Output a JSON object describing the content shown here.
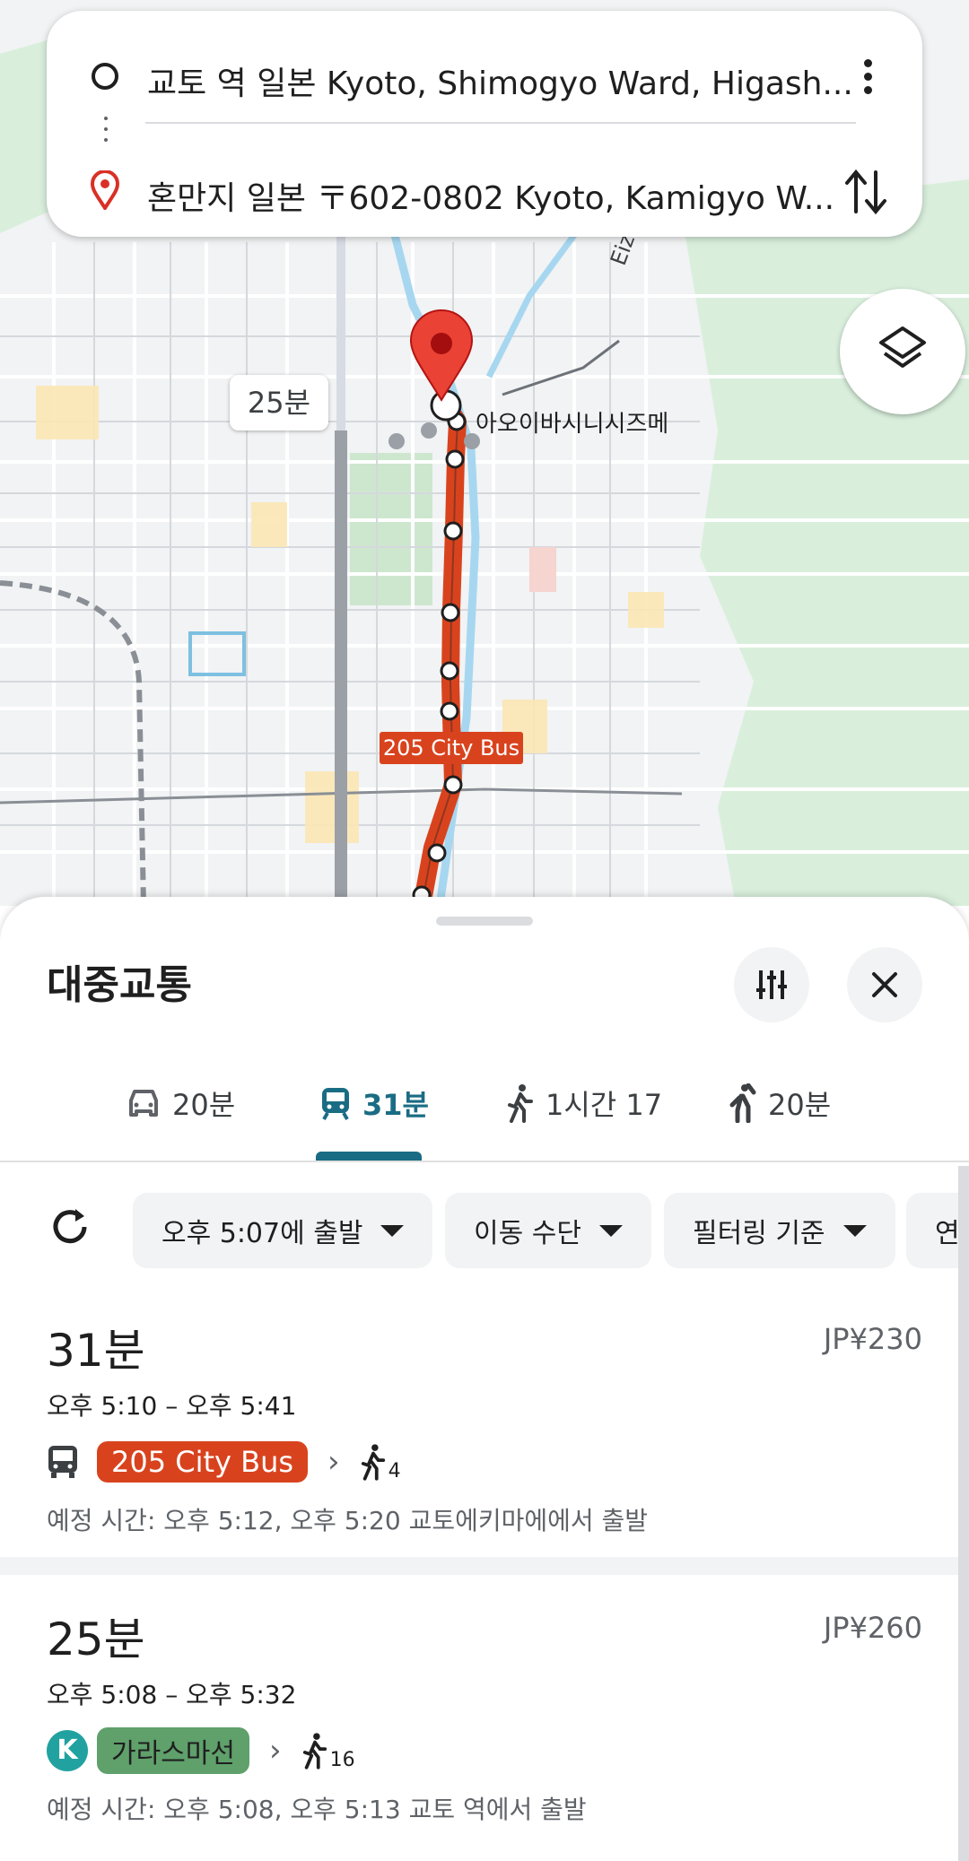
{
  "search": {
    "origin": "교토 역 일본 Kyoto, Shimogyo Ward, Higash...",
    "destination": "혼만지 일본 〒602-0802 Kyoto, Kamigyo W..."
  },
  "map": {
    "time_bubble": "25분",
    "bus_label": "205 City Bus",
    "poi": "아오이바시니시즈메",
    "road_label": "Eizan-Ele",
    "colors": {
      "bus_route": "#d8431e",
      "rail_route": "#9aa0a6",
      "park": "#c8e6c9"
    }
  },
  "sheet": {
    "title": "대중교통",
    "tabs": [
      {
        "icon": "car-icon",
        "label": "20분"
      },
      {
        "icon": "transit-icon",
        "label": "31분"
      },
      {
        "icon": "walk-icon",
        "label": "1시간 17"
      },
      {
        "icon": "ride-hail-icon",
        "label": "20분"
      }
    ],
    "chips": {
      "depart": "오후 5:07에 출발",
      "mode": "이동 수단",
      "filter": "필터링 기준",
      "more": "연결"
    }
  },
  "routes": [
    {
      "duration": "31분",
      "price": "JP¥230",
      "time_range": "오후 5:10 – 오후 5:41",
      "line": "205 City Bus",
      "walk": "4",
      "note": "예정 시간: 오후 5:12, 오후 5:20 교토에키마에에서 출발"
    },
    {
      "duration": "25분",
      "price": "JP¥260",
      "time_range": "오후 5:08 – 오후 5:32",
      "line_badge": "K",
      "line": "가라스마선",
      "walk": "16",
      "note": "예정 시간: 오후 5:08, 오후 5:13 교토 역에서 출발"
    }
  ]
}
